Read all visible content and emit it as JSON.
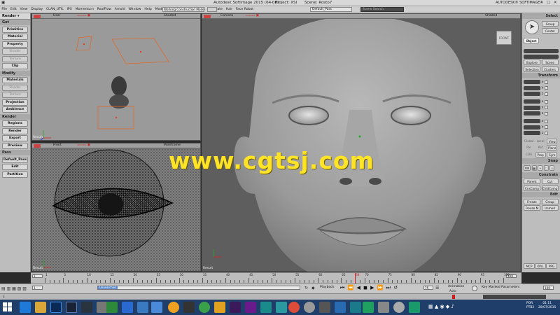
{
  "title": {
    "app": "Autodesk Softimage 2015 (64-bit)",
    "project": "Project: XSI",
    "scene": "Scene: Rosto7",
    "brand": "AUTODESK® SOFTIMAGE®"
  },
  "menu": [
    "File",
    "Edit",
    "View",
    "Display",
    "CLAN_UTIL",
    "IPX",
    "Momentum",
    "RealFlow",
    "Arnold",
    "Window",
    "Help",
    "Model",
    "Animate",
    "Render",
    "ICE",
    "Simulate",
    "Hair",
    "Face Robot"
  ],
  "toolbar": {
    "construction_mode": "Working Construction Mode",
    "pass": "Default_Pass",
    "search_placeholder": "Scene Search"
  },
  "left_panel": {
    "mode": "Render",
    "sections": [
      {
        "title": "Get",
        "items": [
          {
            "label": "Primitive",
            "dim": false
          },
          {
            "label": "Material",
            "dim": false
          },
          {
            "label": "Property",
            "dim": false
          },
          {
            "label": "Shader",
            "dim": true
          },
          {
            "label": "Texture",
            "dim": true
          },
          {
            "label": "Clip",
            "dim": false
          }
        ]
      },
      {
        "title": "Modify",
        "items": [
          {
            "label": "Materials",
            "dim": false
          },
          {
            "label": "Shader",
            "dim": true
          },
          {
            "label": "Texture",
            "dim": true
          },
          {
            "label": "Projection",
            "dim": false
          },
          {
            "label": "Ambience",
            "dim": false
          }
        ]
      },
      {
        "title": "Render",
        "items": [
          {
            "label": "Regions",
            "dim": false
          },
          {
            "label": "Render",
            "dim": false
          },
          {
            "label": "Export",
            "dim": false
          },
          {
            "label": "Preview",
            "dim": false
          }
        ]
      },
      {
        "title": "Pass",
        "items": [
          {
            "label": "Default_Pass",
            "dim": false
          },
          {
            "label": "Edit",
            "dim": false
          },
          {
            "label": "Partition",
            "dim": false
          }
        ]
      }
    ]
  },
  "viewports": {
    "top_left": {
      "camera": "User",
      "mode": "Shaded",
      "result": "Result"
    },
    "bottom_left": {
      "camera": "Front",
      "mode": "Wireframe",
      "result": "Result"
    },
    "main": {
      "camera": "Camera",
      "mode": "Shaded",
      "result": "Result",
      "cube": "FRONT"
    }
  },
  "right_panel": {
    "select_title": "Select",
    "group_label": "Group",
    "center_label": "Center",
    "object_label": "Object",
    "explore_label": "Explore",
    "scene_label": "Scene",
    "selection_label": "Selection",
    "clusters_label": "Clusters",
    "transform_title": "Transform",
    "axes": [
      "x",
      "y",
      "z"
    ],
    "global_label": "Global",
    "local_label": "Local",
    "view_label": "View",
    "par_label": "Par",
    "ref_label": "Ref",
    "plane_label": "Plane",
    "cog_label": "COG",
    "prop_label": "Prop",
    "sym_label": "Sym",
    "snap_title": "Snap",
    "on_label": "ON",
    "constrain_title": "Constrain",
    "parent_label": "Parent",
    "cut_label": "Cut",
    "cnscomp_label": "CnsComp",
    "chldcomp_label": "ChldComp",
    "edit_title": "Edit",
    "freeze_label": "Freeze",
    "group2_label": "Group",
    "freezem_label": "Freeze M",
    "immed_label": "Immed",
    "tabs": [
      "MCP",
      "KP/L",
      "PPG"
    ]
  },
  "timeline": {
    "start": "1",
    "end": "100",
    "ticks": [
      "1",
      "5",
      "10",
      "15",
      "20",
      "25",
      "30",
      "35",
      "40",
      "45",
      "50",
      "55",
      "60",
      "65",
      "70",
      "75",
      "80",
      "85",
      "90",
      "95",
      "100"
    ],
    "current": "68"
  },
  "transport": {
    "start_frame": "1",
    "end_frame": "100",
    "playback_label": "Playback",
    "frame_value": "75",
    "animation_label": "Animation",
    "auto_label": "Auto",
    "key_marked_label": "Key Marked Parameters",
    "search_value": "Unsearched"
  },
  "taskbar": {
    "language": "POR",
    "layout": "PTB2",
    "time": "01:11",
    "date": "20/07/2015"
  },
  "watermark": "www.cgtsj.com",
  "colors": {
    "accent": "#5b8ccf",
    "timeline_cursor": "#d21a1a",
    "watermark": "#ffe326",
    "taskbar": "#1f3f6a"
  }
}
